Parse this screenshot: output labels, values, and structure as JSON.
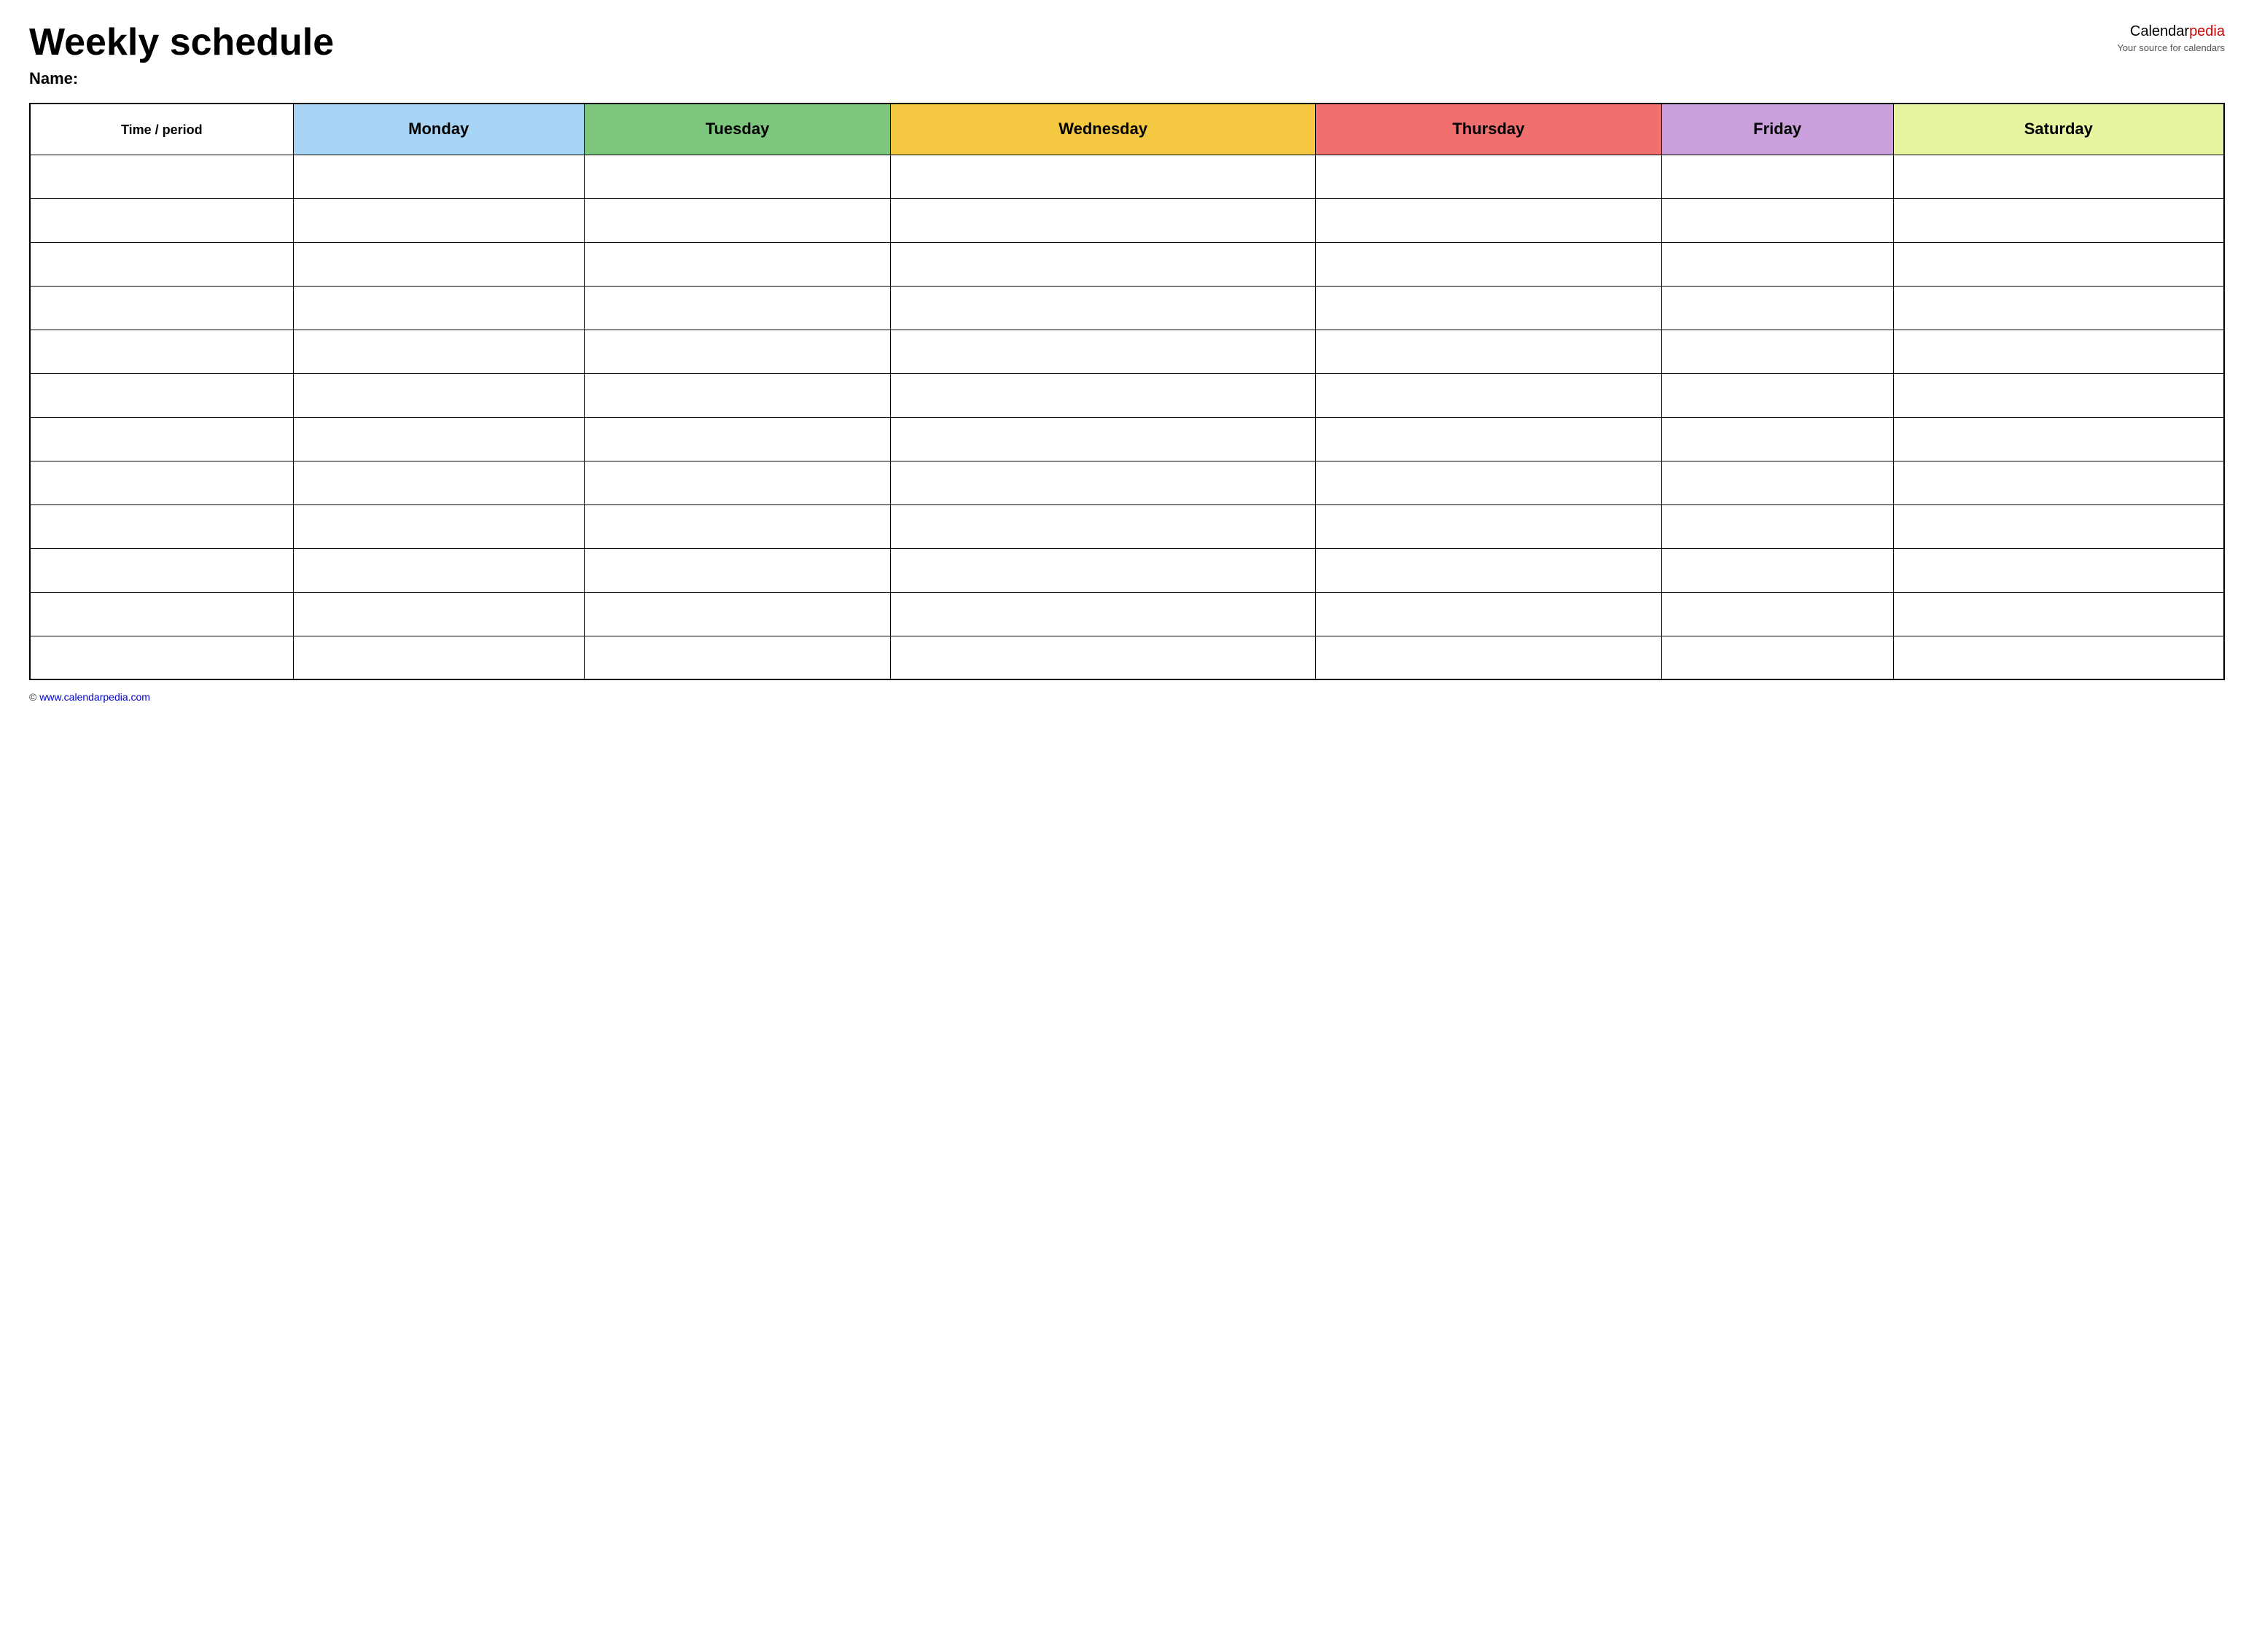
{
  "header": {
    "title": "Weekly schedule",
    "name_label": "Name:",
    "logo_calendar": "Calendar",
    "logo_pedia": "pedia",
    "logo_tagline": "Your source for calendars"
  },
  "table": {
    "columns": [
      {
        "id": "time",
        "label": "Time / period",
        "color": "#ffffff"
      },
      {
        "id": "monday",
        "label": "Monday",
        "color": "#a8d4f5"
      },
      {
        "id": "tuesday",
        "label": "Tuesday",
        "color": "#7dc67d"
      },
      {
        "id": "wednesday",
        "label": "Wednesday",
        "color": "#f5c842"
      },
      {
        "id": "thursday",
        "label": "Thursday",
        "color": "#f07070"
      },
      {
        "id": "friday",
        "label": "Friday",
        "color": "#c9a0dc"
      },
      {
        "id": "saturday",
        "label": "Saturday",
        "color": "#e8f5a0"
      }
    ],
    "rows": 12
  },
  "footer": {
    "url": "www.calendarpedia.com"
  }
}
